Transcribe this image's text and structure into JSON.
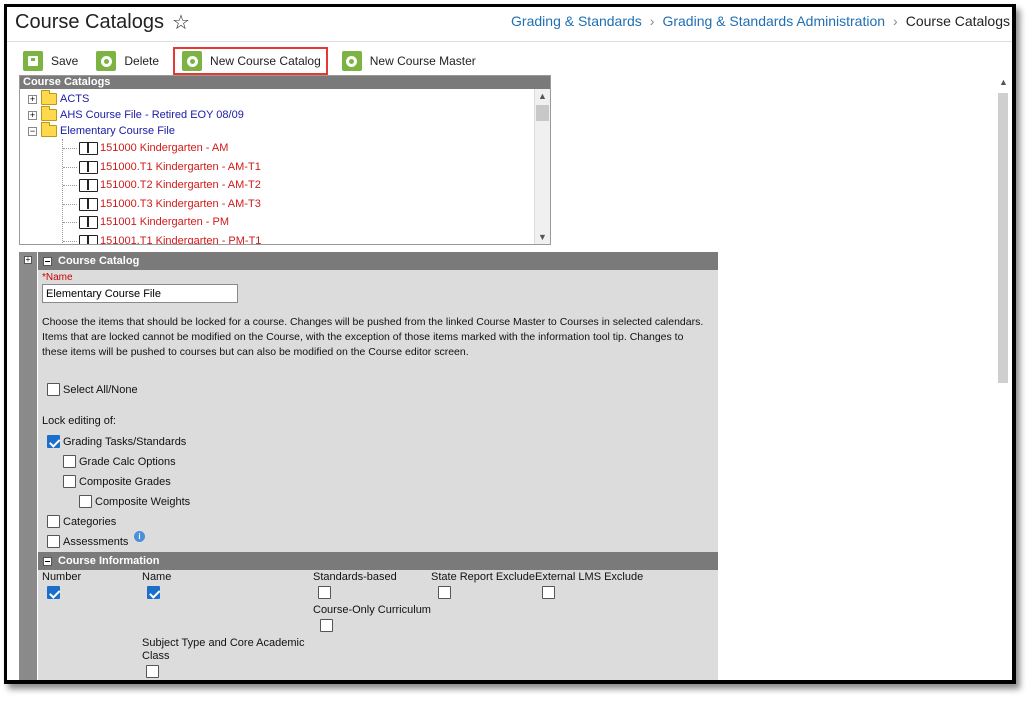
{
  "header": {
    "title": "Course Catalogs",
    "breadcrumb": [
      "Grading & Standards",
      "Grading & Standards Administration",
      "Course Catalogs"
    ]
  },
  "toolbar": {
    "save": "Save",
    "delete": "Delete",
    "new_catalog": "New Course Catalog",
    "new_master": "New Course Master"
  },
  "tree": {
    "title": "Course Catalogs",
    "folders": [
      "ACTS",
      "AHS Course File - Retired EOY 08/09",
      "Elementary Course File"
    ],
    "courses": [
      "151000 Kindergarten - AM",
      "151000.T1 Kindergarten - AM-T1",
      "151000.T2 Kindergarten - AM-T2",
      "151000.T3 Kindergarten - AM-T3",
      "151001 Kindergarten - PM",
      "151001.T1 Kindergarten - PM-T1"
    ]
  },
  "catalog": {
    "section_title": "Course Catalog",
    "name_label": "*Name",
    "name_value": "Elementary Course File",
    "description": "Choose the items that should be locked for a course. Changes will be pushed from the linked Course Master to Courses in selected calendars. Items that are locked cannot be modified on the Course, with the exception of those items marked with the information tool tip. Changes to these items will be pushed to courses but can also be modified on the Course editor screen.",
    "select_all": "Select All/None",
    "lock_label": "Lock editing of:",
    "options": {
      "grading_tasks": "Grading Tasks/Standards",
      "grade_calc": "Grade Calc Options",
      "composite_grades": "Composite Grades",
      "composite_weights": "Composite Weights",
      "categories": "Categories",
      "assessments": "Assessments"
    }
  },
  "course_info": {
    "section_title": "Course Information",
    "fields": {
      "number": "Number",
      "name": "Name",
      "standards_based": "Standards-based",
      "state_report": "State Report Exclude",
      "external_lms": "External LMS Exclude",
      "course_only": "Course-Only Curriculum",
      "subject_type_1": "Subject Type and Core Academic",
      "subject_type_2": "Class"
    }
  },
  "colors": {
    "accent_green": "#7cb342",
    "highlight_red": "#e53935",
    "link_blue": "#1f6fb2",
    "course_red": "#d11a1a",
    "checkbox_blue": "#1c6fc9"
  }
}
